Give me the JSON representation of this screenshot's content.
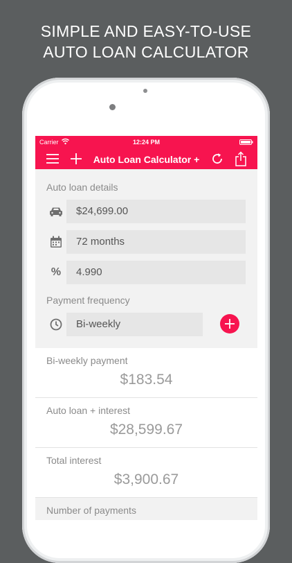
{
  "promo": {
    "line1": "SIMPLE AND EASY-TO-USE",
    "line2": "AUTO LOAN CALCULATOR"
  },
  "status_bar": {
    "carrier": "Carrier",
    "time": "12:24 PM"
  },
  "nav": {
    "title": "Auto Loan Calculator +"
  },
  "details": {
    "section_label": "Auto loan details",
    "loan_amount": "$24,699.00",
    "term": "72 months",
    "rate": "4.990",
    "percent_symbol": "%"
  },
  "frequency": {
    "section_label": "Payment frequency",
    "selected": "Bi-weekly"
  },
  "results": [
    {
      "label": "Bi-weekly payment",
      "value": "$183.54"
    },
    {
      "label": "Auto loan + interest",
      "value": "$28,599.67"
    },
    {
      "label": "Total interest",
      "value": "$3,900.67"
    },
    {
      "label": "Number of payments",
      "value": ""
    }
  ],
  "colors": {
    "accent": "#f7144f",
    "background": "#5b5e5f"
  }
}
